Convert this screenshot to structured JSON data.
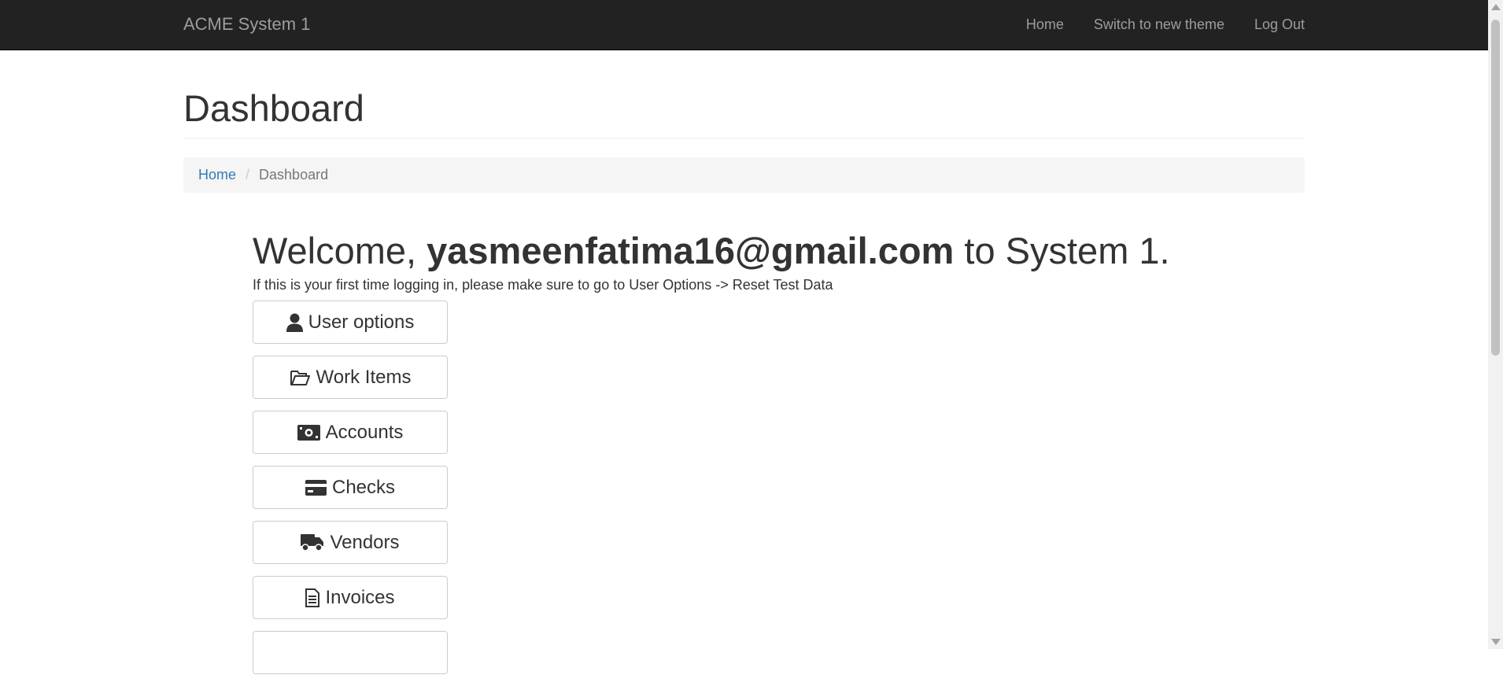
{
  "navbar": {
    "brand": "ACME System 1",
    "links": [
      "Home",
      "Switch to new theme",
      "Log Out"
    ]
  },
  "page": {
    "title": "Dashboard"
  },
  "breadcrumb": {
    "home": "Home",
    "separator": "/",
    "current": "Dashboard"
  },
  "welcome": {
    "prefix": "Welcome, ",
    "user": "yasmeenfatima16@gmail.com",
    "suffix": " to System 1.",
    "hint": "If this is your first time logging in, please make sure to go to User Options -> Reset Test Data"
  },
  "menu": [
    {
      "label": "User options",
      "icon": "user-icon"
    },
    {
      "label": "Work Items",
      "icon": "folder-open-icon"
    },
    {
      "label": "Accounts",
      "icon": "money-bill-icon"
    },
    {
      "label": "Checks",
      "icon": "credit-card-icon"
    },
    {
      "label": "Vendors",
      "icon": "truck-icon"
    },
    {
      "label": "Invoices",
      "icon": "file-invoice-icon"
    }
  ],
  "colors": {
    "navbar_bg": "#222222",
    "nav_text": "#9d9d9d",
    "link": "#337ab7",
    "breadcrumb_bg": "#f5f5f5"
  }
}
